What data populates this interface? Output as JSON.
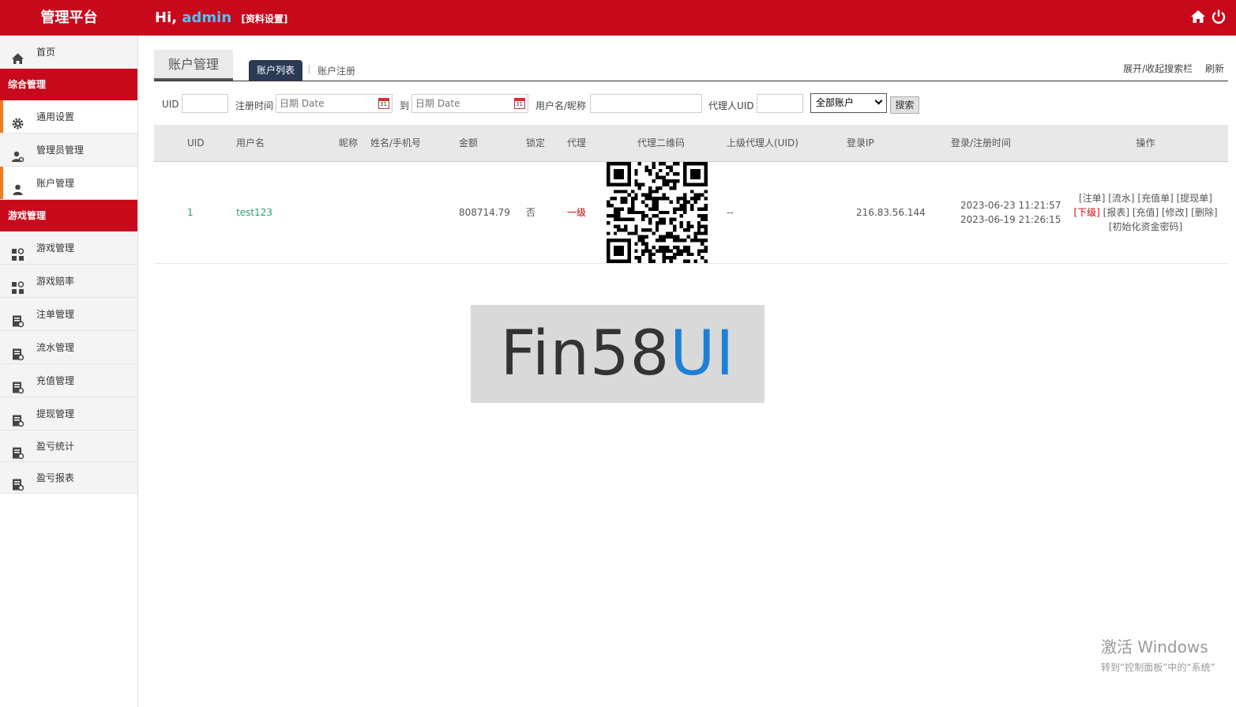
{
  "app": {
    "brand": "管理平台",
    "hi": "Hi,",
    "username": "admin",
    "profile_link": "[资料设置]"
  },
  "icons": {
    "home": "home-icon",
    "power": "power-icon"
  },
  "sidebar": {
    "home": "首页",
    "section1": "综合管理",
    "section1_items": [
      "通用设置",
      "管理员管理",
      "账户管理"
    ],
    "section2": "游戏管理",
    "section2_items": [
      "游戏管理",
      "游戏赔率",
      "注单管理",
      "流水管理",
      "充值管理",
      "提现管理",
      "盈亏统计",
      "盈亏报表"
    ]
  },
  "page": {
    "title": "账户管理",
    "tab_active": "账户列表",
    "tab_other": "账户注册",
    "toggle_search": "展开/收起搜索栏",
    "refresh": "刷新"
  },
  "search": {
    "uid_label": "UID",
    "reg_time_label": "注册时间",
    "date_placeholder": "日期 Date",
    "to_label": "到",
    "name_label": "用户名/昵称",
    "agent_uid_label": "代理人UID",
    "account_type": "全部账户",
    "search_button": "搜索"
  },
  "table": {
    "headers": [
      "UID",
      "用户名",
      "昵称",
      "姓名/手机号",
      "金额",
      "锁定",
      "代理",
      "代理二维码",
      "上级代理人(UID)",
      "登录IP",
      "登录/注册时间",
      "操作"
    ],
    "rows": [
      {
        "uid": "1",
        "username": "test123",
        "nickname": "",
        "name_phone": "",
        "amount": "808714.79",
        "locked": "否",
        "agent": "一级",
        "parent_agent": "--",
        "login_ip": "216.83.56.144",
        "login_time": "2023-06-23 11:21:57",
        "reg_time": "2023-06-19 21:26:15",
        "ops_line1": "[注单] [流水] [充值单] [提现单]",
        "ops_sub": "[下级]",
        "ops_line2": " [报表] [充值] [修改] [删除]",
        "ops_line3": "[初始化资金密码]"
      }
    ]
  },
  "watermark": {
    "text": "Fin58",
    "accent": "UI",
    "accent_color": "#1e7fd6"
  },
  "os_notice": {
    "line1": "激活 Windows",
    "line2": "转到“控制面板”中的“系统”"
  },
  "colors": {
    "brand_red": "#c8091c",
    "active_orange": "#f37b1d",
    "tab_dark": "#2b3a55"
  }
}
